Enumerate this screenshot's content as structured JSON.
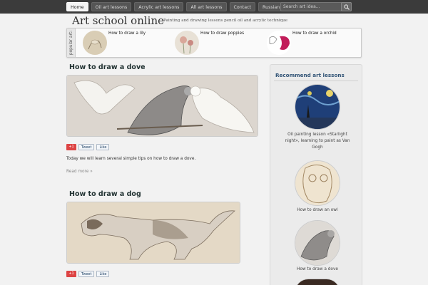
{
  "nav": {
    "items": [
      "Home",
      "Oil art lessons",
      "Acrylic art lessons",
      "All art lessons",
      "Contact",
      "Russian"
    ],
    "search_placeholder": "Search art idea..."
  },
  "header": {
    "site_title": "Art school online",
    "tagline": "Painting and drawing lessons pencil oil and acrylic technique"
  },
  "popular": {
    "label": "popular art:",
    "items": [
      "How to draw a lily",
      "How to draw poppies",
      "How to draw a orchid"
    ]
  },
  "posts": [
    {
      "title": "How to draw a dove",
      "excerpt": "Today we will learn several simple tips on how to draw a dove.",
      "read_more": "Read more »"
    },
    {
      "title": "How to draw a dog"
    }
  ],
  "social": {
    "gplus": "+1",
    "tweet": "Tweet",
    "like": "Like"
  },
  "sidebar": {
    "title": "Recommend art lessons",
    "lessons": [
      "Oil painting lesson «Starlight night», learning to paint as Van Gogh",
      "How to draw an owl",
      "How to draw a dove"
    ]
  },
  "colors": {
    "topbar": "#3b3b3b",
    "accent_title": "#335577",
    "gplus": "#dd4444"
  }
}
